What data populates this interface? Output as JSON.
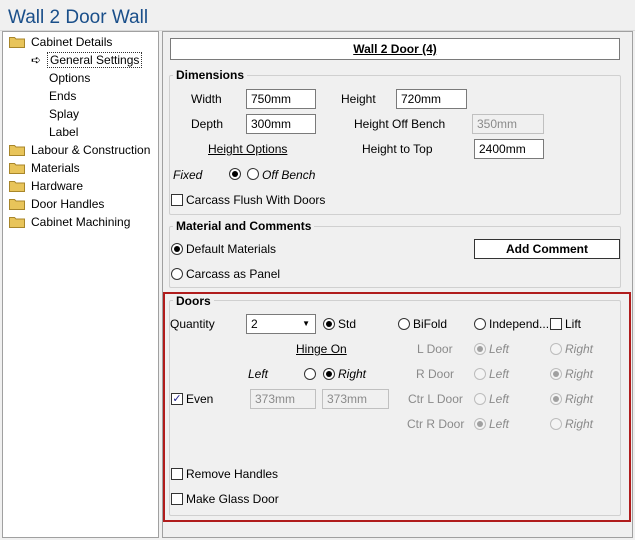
{
  "window": {
    "title": "Wall 2 Door Wall"
  },
  "tree": {
    "items": [
      {
        "label": "Cabinet Details"
      },
      {
        "label": "General Settings"
      },
      {
        "label": "Options"
      },
      {
        "label": "Ends"
      },
      {
        "label": "Splay"
      },
      {
        "label": "Label"
      },
      {
        "label": "Labour & Construction"
      },
      {
        "label": "Materials"
      },
      {
        "label": "Hardware"
      },
      {
        "label": "Door Handles"
      },
      {
        "label": "Cabinet Machining"
      }
    ]
  },
  "header": {
    "title": "Wall 2 Door (4)"
  },
  "dimensions": {
    "title": "Dimensions",
    "width_label": "Width",
    "width_value": "750mm",
    "height_label": "Height",
    "height_value": "720mm",
    "depth_label": "Depth",
    "depth_value": "300mm",
    "height_off_bench_label": "Height Off Bench",
    "height_off_bench_value": "350mm",
    "height_options_label": "Height Options",
    "height_to_top_label": "Height to Top",
    "height_to_top_value": "2400mm",
    "fixed_label": "Fixed",
    "off_bench_label": "Off Bench",
    "carcass_flush_label": "Carcass Flush With Doors"
  },
  "material": {
    "title": "Material and Comments",
    "default_materials_label": "Default Materials",
    "carcass_panel_label": "Carcass as Panel",
    "add_comment_label": "Add Comment"
  },
  "doors": {
    "title": "Doors",
    "quantity_label": "Quantity",
    "quantity_value": "2",
    "std_label": "Std",
    "bifold_label": "BiFold",
    "independ_label": "Independ...",
    "lift_label": "Lift",
    "hinge_on_label": "Hinge On",
    "left_label": "Left",
    "right_label": "Right",
    "even_label": "Even",
    "even_left_value": "373mm",
    "even_right_value": "373mm",
    "l_door_label": "L Door",
    "r_door_label": "R Door",
    "ctr_l_door_label": "Ctr L Door",
    "ctr_r_door_label": "Ctr R Door",
    "remove_handles_label": "Remove Handles",
    "make_glass_door_label": "Make Glass Door"
  },
  "colors": {
    "title_blue": "#1a4f8a",
    "highlight_red": "#b01c1c",
    "folder_yellow": "#e8c45a"
  }
}
